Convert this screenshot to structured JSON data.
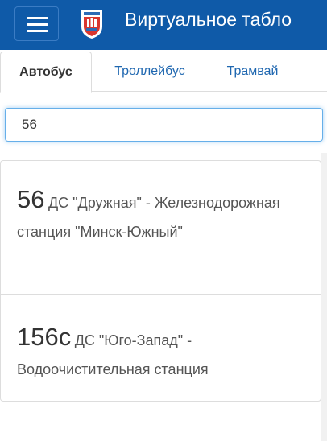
{
  "header": {
    "title": "Виртуальное табло",
    "menu_icon": "hamburger-icon",
    "logo_icon": "city-coat-of-arms-logo",
    "brand_color": "#0f5aa8"
  },
  "tabs": [
    {
      "label": "Автобус",
      "active": true
    },
    {
      "label": "Троллейбус",
      "active": false
    },
    {
      "label": "Трамвай",
      "active": false
    }
  ],
  "search": {
    "value": "56"
  },
  "routes": [
    {
      "number": "56",
      "description": "ДС \"Дружная\" - Железнодорожная станция \"Минск-Южный\""
    },
    {
      "number": "156с",
      "description": "ДС \"Юго-Запад\" - Водоочистительная станция"
    }
  ]
}
